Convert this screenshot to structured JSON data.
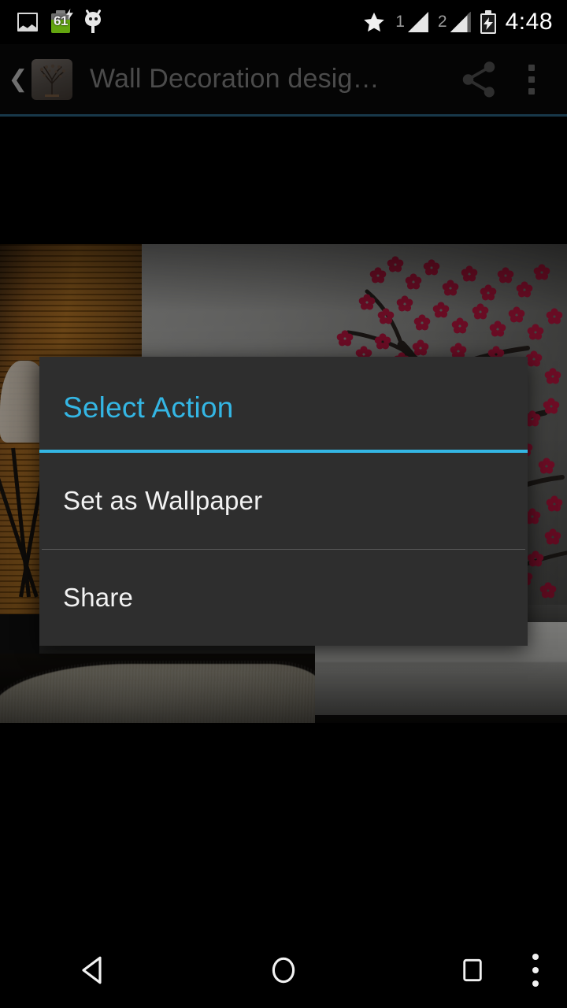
{
  "status_bar": {
    "icons_left": [
      "photo-icon",
      "battery-percent-icon",
      "android-droid-icon"
    ],
    "battery_percent": "61",
    "star_icon": "star-icon",
    "sim1_label": "1",
    "sim2_label": "2",
    "charging_icon": "battery-charging-icon",
    "time": "4:48"
  },
  "action_bar": {
    "back_glyph": "❮",
    "app_icon": "tree-wall-decal-icon",
    "title": "Wall Decoration desig…",
    "share_icon": "share-icon",
    "overflow_icon": "overflow-menu-icon",
    "accent_underline_color": "#18384a"
  },
  "content": {
    "image_alt": "Living room with cherry blossom wall decal",
    "blossom_color": "#9e1336",
    "wall_color": "#8e8e8c",
    "wood_color": "#7d4a12"
  },
  "dialog": {
    "title": "Select Action",
    "accent_color": "#34b6e4",
    "background_color": "#2e2e2e",
    "items": [
      {
        "label": "Set as Wallpaper"
      },
      {
        "label": "Share"
      }
    ]
  },
  "nav_bar": {
    "back_label": "back-button",
    "home_label": "home-button",
    "recents_label": "recents-button",
    "menu_label": "menu-button"
  }
}
